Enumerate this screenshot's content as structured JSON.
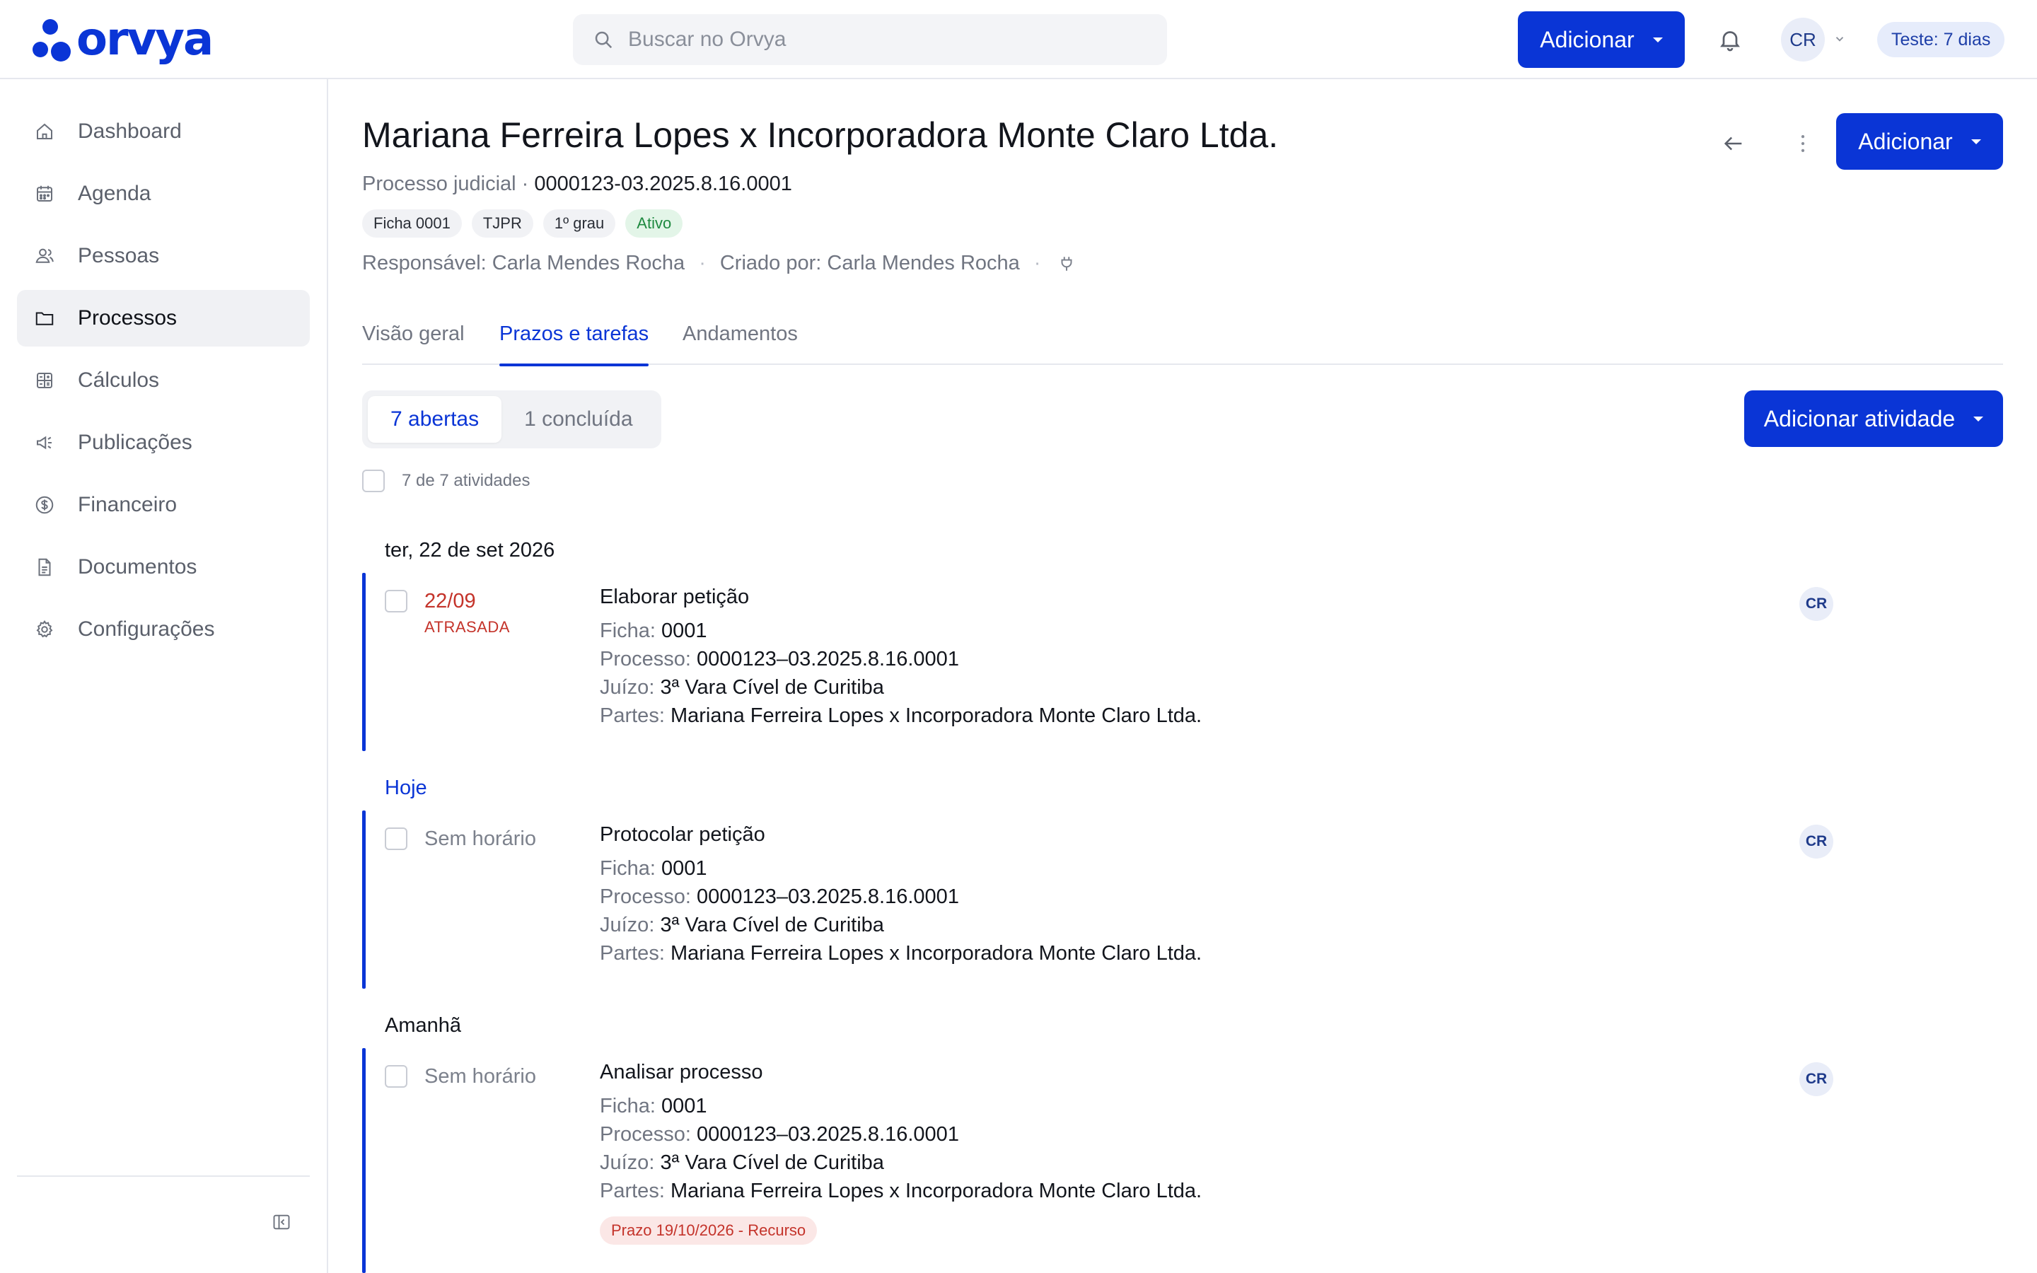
{
  "app": {
    "logo_text": "orvya"
  },
  "topbar": {
    "search_placeholder": "Buscar no Orvya",
    "add_label": "Adicionar",
    "avatar": "CR",
    "trial": "Teste: 7 dias"
  },
  "sidebar": {
    "items": [
      {
        "label": "Dashboard",
        "icon": "home-icon"
      },
      {
        "label": "Agenda",
        "icon": "calendar-icon"
      },
      {
        "label": "Pessoas",
        "icon": "people-icon"
      },
      {
        "label": "Processos",
        "icon": "folder-icon",
        "active": true
      },
      {
        "label": "Cálculos",
        "icon": "calculator-icon"
      },
      {
        "label": "Publicações",
        "icon": "megaphone-icon"
      },
      {
        "label": "Financeiro",
        "icon": "dollar-circle-icon"
      },
      {
        "label": "Documentos",
        "icon": "document-icon"
      },
      {
        "label": "Configurações",
        "icon": "gear-icon"
      }
    ]
  },
  "case": {
    "title": "Mariana Ferreira Lopes x Incorporadora Monte Claro Ltda.",
    "type": "Processo judicial",
    "separator": "·",
    "number": "0000123-03.2025.8.16.0001",
    "chips": [
      "Ficha 0001",
      "TJPR",
      "1º grau",
      "Ativo"
    ],
    "responsible": "Responsável: Carla Mendes Rocha",
    "created_by": "Criado por: Carla Mendes Rocha",
    "dot": "·",
    "add_label": "Adicionar"
  },
  "tabs": [
    {
      "label": "Visão geral"
    },
    {
      "label": "Prazos e tarefas",
      "active": true
    },
    {
      "label": "Andamentos"
    }
  ],
  "filters": {
    "open": "7 abertas",
    "done": "1 concluída",
    "count": "7 de 7 atividades",
    "add_activity": "Adicionar atividade"
  },
  "groups": [
    {
      "label": "ter, 22 de set 2026"
    },
    {
      "label": "Hoje"
    },
    {
      "label": "Amanhã"
    }
  ],
  "field_labels": {
    "ficha": "Ficha:",
    "processo": "Processo:",
    "juizo": "Juízo:",
    "partes": "Partes:"
  },
  "tasks": [
    {
      "due": "22/09",
      "late": "ATRASADA",
      "title": "Elaborar petição",
      "ficha": "0001",
      "processo": "0000123–03.2025.8.16.0001",
      "juizo": "3ª Vara Cível de Curitiba",
      "partes": "Mariana Ferreira Lopes x Incorporadora Monte Claro Ltda.",
      "assignee": "CR"
    },
    {
      "due": "Sem horário",
      "title": "Protocolar petição",
      "ficha": "0001",
      "processo": "0000123–03.2025.8.16.0001",
      "juizo": "3ª Vara Cível de Curitiba",
      "partes": "Mariana Ferreira Lopes x Incorporadora Monte Claro Ltda.",
      "assignee": "CR"
    },
    {
      "due": "Sem horário",
      "title": "Analisar processo",
      "ficha": "0001",
      "processo": "0000123–03.2025.8.16.0001",
      "juizo": "3ª Vara Cível de Curitiba",
      "partes": "Mariana Ferreira Lopes x Incorporadora Monte Claro Ltda.",
      "tag": "Prazo 19/10/2026 - Recurso",
      "assignee": "CR"
    }
  ],
  "colors": {
    "accent": "#0a35d6",
    "late": "#c4332a",
    "active_chip": "#1f8a40"
  }
}
